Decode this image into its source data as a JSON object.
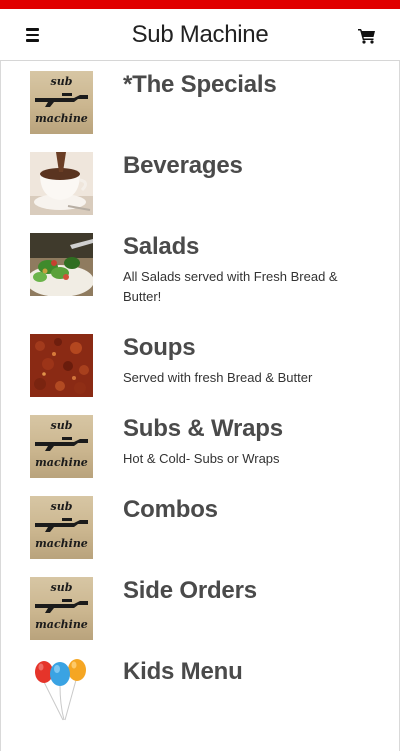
{
  "app": {
    "title": "Sub Machine"
  },
  "header": {
    "menu_icon": "hamburger-icon",
    "cart_icon": "shopping-cart-icon"
  },
  "colors": {
    "accent": "#e00000",
    "text": "#4a4a4a"
  },
  "logo": {
    "line1": "sub",
    "line2": "machine"
  },
  "categories": [
    {
      "name": "*The Specials",
      "description": "",
      "image": "sub-machine-logo"
    },
    {
      "name": "Beverages",
      "description": "",
      "image": "hot-chocolate-photo"
    },
    {
      "name": "Salads",
      "description": "All Salads served with Fresh Bread & Butter!",
      "image": "salad-photo"
    },
    {
      "name": "Soups",
      "description": "Served with fresh Bread & Butter",
      "image": "soup-photo"
    },
    {
      "name": "Subs & Wraps",
      "description": "Hot & Cold- Subs or Wraps",
      "image": "sub-machine-logo"
    },
    {
      "name": "Combos",
      "description": "",
      "image": "sub-machine-logo"
    },
    {
      "name": "Side Orders",
      "description": "",
      "image": "sub-machine-logo"
    },
    {
      "name": "Kids Menu",
      "description": "",
      "image": "balloons-photo"
    }
  ]
}
